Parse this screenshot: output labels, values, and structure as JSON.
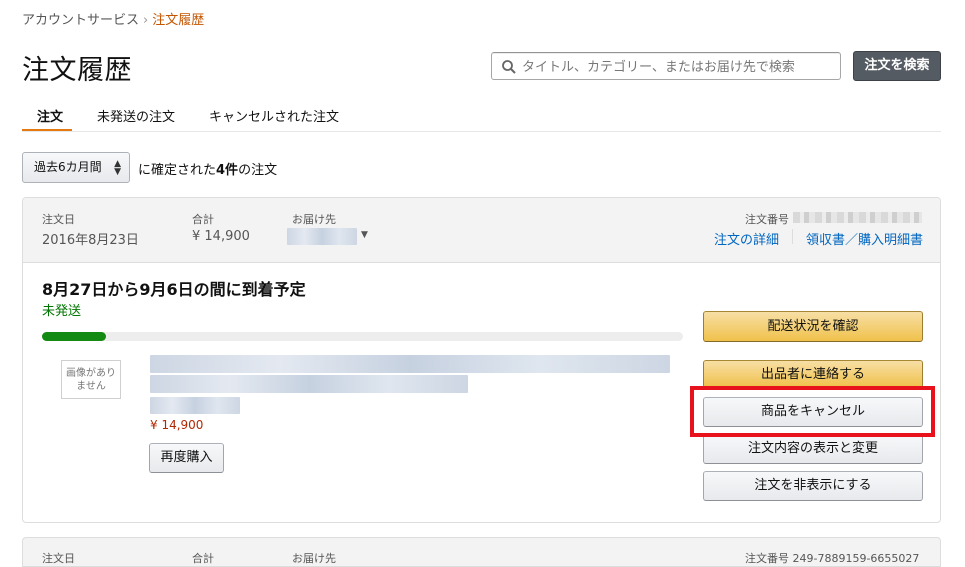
{
  "breadcrumb": {
    "parent": "アカウントサービス",
    "separator": "›",
    "current": "注文履歴"
  },
  "title": "注文履歴",
  "search": {
    "placeholder": "タイトル、カテゴリー、またはお届け先で検索",
    "button_label": "注文を検索"
  },
  "tabs": [
    {
      "label": "注文",
      "active": true
    },
    {
      "label": "未発送の注文",
      "active": false
    },
    {
      "label": "キャンセルされた注文",
      "active": false
    }
  ],
  "filter": {
    "selected": "過去6カ月間",
    "prefix": "に確定された",
    "count": "4件",
    "suffix": "の注文"
  },
  "order": {
    "date_label": "注文日",
    "date": "2016年8月23日",
    "total_label": "合計",
    "total": "¥ 14,900",
    "ship_to_label": "お届け先",
    "order_number_label": "注文番号",
    "details_link": "注文の詳細",
    "receipt_link": "領収書／購入明細書",
    "arrival": "8月27日から9月6日の間に到着予定",
    "status": "未発送",
    "progress": 0.1,
    "no_image_text": "画像がありません",
    "price": "¥ 14,900",
    "rebuy_button": "再度購入",
    "actions": {
      "track": "配送状況を確認",
      "contact_seller": "出品者に連絡する",
      "cancel_items": "商品をキャンセル",
      "view_change": "注文内容の表示と変更",
      "hide_order": "注文を非表示にする"
    }
  },
  "next_order": {
    "date_label": "注文日",
    "total_label": "合計",
    "ship_to_label": "お届け先",
    "order_number": "注文番号 249-7889159-6655027"
  },
  "colors": {
    "accent_orange": "#e47911",
    "link_blue": "#0066c0",
    "status_green": "#007600",
    "price_red": "#b12704",
    "highlight_red": "#e8121c"
  }
}
